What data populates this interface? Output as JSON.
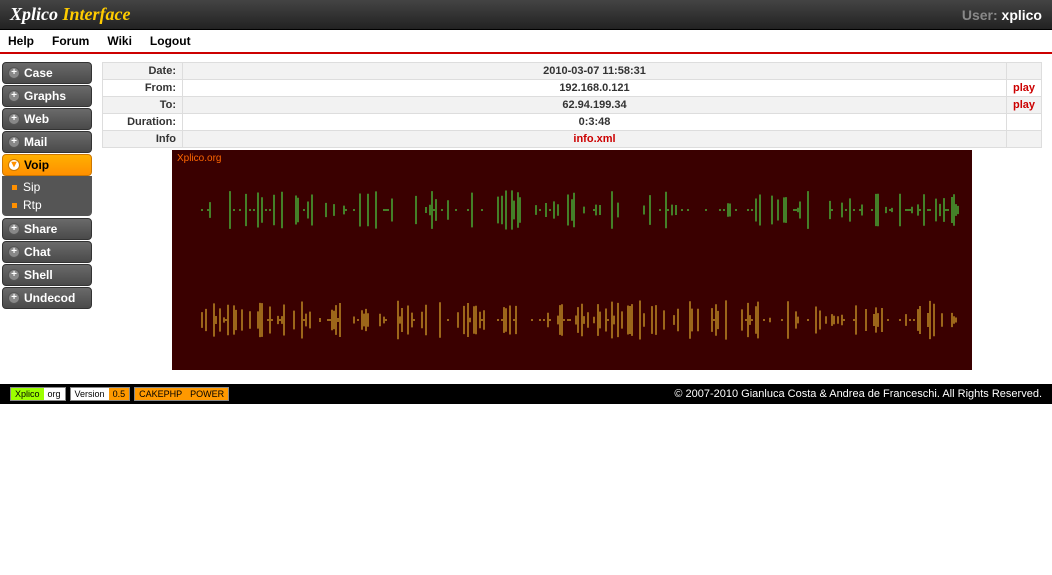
{
  "header": {
    "logo_part1": "Xplico ",
    "logo_part2": "Interface",
    "user_label": "User: ",
    "user_name": "xplico"
  },
  "nav": {
    "help": "Help",
    "forum": "Forum",
    "wiki": "Wiki",
    "logout": "Logout"
  },
  "sidebar": {
    "case": "Case",
    "graphs": "Graphs",
    "web": "Web",
    "mail": "Mail",
    "voip": "Voip",
    "sip": "Sip",
    "rtp": "Rtp",
    "share": "Share",
    "chat": "Chat",
    "shell": "Shell",
    "undecod": "Undecod"
  },
  "details": {
    "date_label": "Date:",
    "date_value": "2010-03-07 11:58:31",
    "from_label": "From:",
    "from_value": "192.168.0.121",
    "from_play": "play",
    "to_label": "To:",
    "to_value": "62.94.199.34",
    "to_play": "play",
    "duration_label": "Duration:",
    "duration_value": "0:3:48",
    "info_label": "Info",
    "info_value": "info.xml"
  },
  "waveform": {
    "label": "Xplico.org"
  },
  "footer": {
    "badge1_left": "Xplico",
    "badge1_right": "org",
    "badge2_left": "Version",
    "badge2_right": "0.5",
    "badge3_left": "CAKEPHP",
    "badge3_right": "POWER",
    "copyright": "© 2007-2010 Gianluca Costa & Andrea de Franceschi. All Rights Reserved."
  }
}
